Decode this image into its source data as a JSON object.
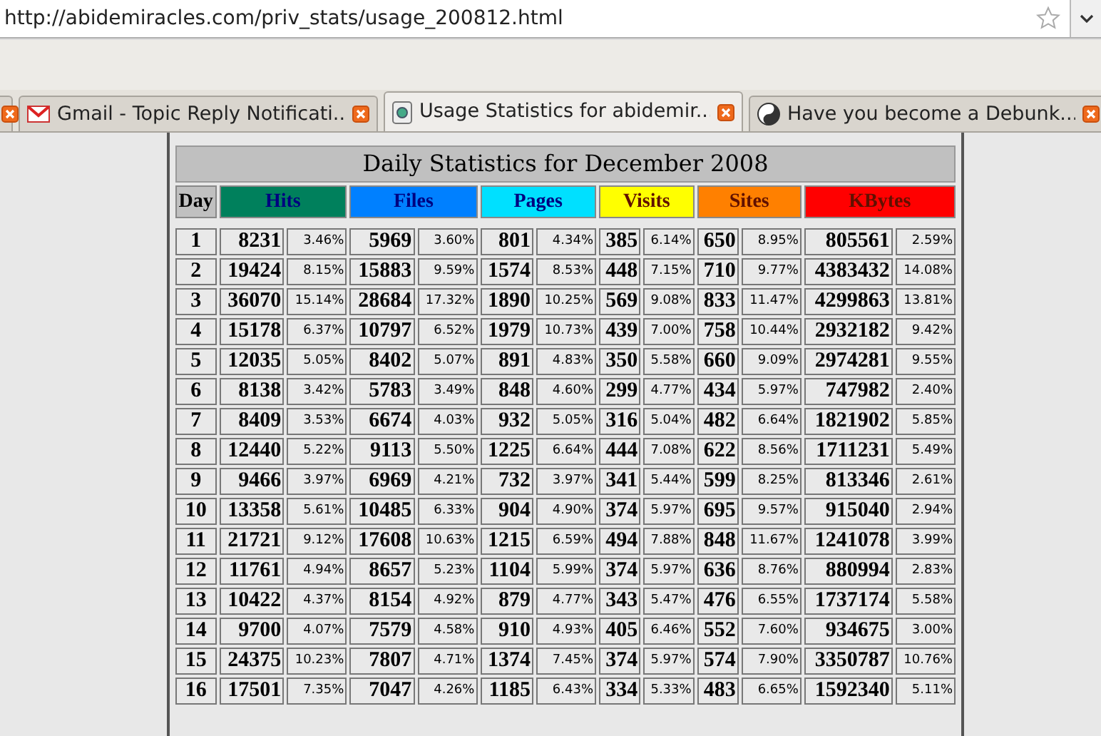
{
  "address_bar": {
    "url": "http://abidemiracles.com/priv_stats/usage_200812.html"
  },
  "tabs": [
    {
      "selected": false,
      "kind": "partial"
    },
    {
      "title": "Gmail - Topic Reply Notificati...",
      "selected": false,
      "kind": "mail"
    },
    {
      "title": "Usage Statistics for abidemir...",
      "selected": true,
      "kind": "page"
    },
    {
      "title": "Have you become a Debunk...",
      "selected": false,
      "kind": "yinyang"
    }
  ],
  "table": {
    "title": "Daily Statistics for December 2008",
    "columns": [
      {
        "label": "Day",
        "color": "#c0c0c0",
        "kind": "day"
      },
      {
        "label": "Hits",
        "color": "#00805c",
        "kind": "metric"
      },
      {
        "label": "Files",
        "color": "#0080ff",
        "kind": "metric"
      },
      {
        "label": "Pages",
        "color": "#00e0ff",
        "kind": "metric"
      },
      {
        "label": "Visits",
        "color": "#ffff00",
        "kind": "metric"
      },
      {
        "label": "Sites",
        "color": "#ff8000",
        "kind": "metric"
      },
      {
        "label": "KBytes",
        "color": "#ff0000",
        "kind": "metric"
      }
    ],
    "rows": [
      {
        "day": "1",
        "values": [
          [
            "8231",
            "3.46%"
          ],
          [
            "5969",
            "3.60%"
          ],
          [
            "801",
            "4.34%"
          ],
          [
            "385",
            "6.14%"
          ],
          [
            "650",
            "8.95%"
          ],
          [
            "805561",
            "2.59%"
          ]
        ]
      },
      {
        "day": "2",
        "values": [
          [
            "19424",
            "8.15%"
          ],
          [
            "15883",
            "9.59%"
          ],
          [
            "1574",
            "8.53%"
          ],
          [
            "448",
            "7.15%"
          ],
          [
            "710",
            "9.77%"
          ],
          [
            "4383432",
            "14.08%"
          ]
        ]
      },
      {
        "day": "3",
        "values": [
          [
            "36070",
            "15.14%"
          ],
          [
            "28684",
            "17.32%"
          ],
          [
            "1890",
            "10.25%"
          ],
          [
            "569",
            "9.08%"
          ],
          [
            "833",
            "11.47%"
          ],
          [
            "4299863",
            "13.81%"
          ]
        ]
      },
      {
        "day": "4",
        "values": [
          [
            "15178",
            "6.37%"
          ],
          [
            "10797",
            "6.52%"
          ],
          [
            "1979",
            "10.73%"
          ],
          [
            "439",
            "7.00%"
          ],
          [
            "758",
            "10.44%"
          ],
          [
            "2932182",
            "9.42%"
          ]
        ]
      },
      {
        "day": "5",
        "values": [
          [
            "12035",
            "5.05%"
          ],
          [
            "8402",
            "5.07%"
          ],
          [
            "891",
            "4.83%"
          ],
          [
            "350",
            "5.58%"
          ],
          [
            "660",
            "9.09%"
          ],
          [
            "2974281",
            "9.55%"
          ]
        ]
      },
      {
        "day": "6",
        "values": [
          [
            "8138",
            "3.42%"
          ],
          [
            "5783",
            "3.49%"
          ],
          [
            "848",
            "4.60%"
          ],
          [
            "299",
            "4.77%"
          ],
          [
            "434",
            "5.97%"
          ],
          [
            "747982",
            "2.40%"
          ]
        ]
      },
      {
        "day": "7",
        "values": [
          [
            "8409",
            "3.53%"
          ],
          [
            "6674",
            "4.03%"
          ],
          [
            "932",
            "5.05%"
          ],
          [
            "316",
            "5.04%"
          ],
          [
            "482",
            "6.64%"
          ],
          [
            "1821902",
            "5.85%"
          ]
        ]
      },
      {
        "day": "8",
        "values": [
          [
            "12440",
            "5.22%"
          ],
          [
            "9113",
            "5.50%"
          ],
          [
            "1225",
            "6.64%"
          ],
          [
            "444",
            "7.08%"
          ],
          [
            "622",
            "8.56%"
          ],
          [
            "1711231",
            "5.49%"
          ]
        ]
      },
      {
        "day": "9",
        "values": [
          [
            "9466",
            "3.97%"
          ],
          [
            "6969",
            "4.21%"
          ],
          [
            "732",
            "3.97%"
          ],
          [
            "341",
            "5.44%"
          ],
          [
            "599",
            "8.25%"
          ],
          [
            "813346",
            "2.61%"
          ]
        ]
      },
      {
        "day": "10",
        "values": [
          [
            "13358",
            "5.61%"
          ],
          [
            "10485",
            "6.33%"
          ],
          [
            "904",
            "4.90%"
          ],
          [
            "374",
            "5.97%"
          ],
          [
            "695",
            "9.57%"
          ],
          [
            "915040",
            "2.94%"
          ]
        ]
      },
      {
        "day": "11",
        "values": [
          [
            "21721",
            "9.12%"
          ],
          [
            "17608",
            "10.63%"
          ],
          [
            "1215",
            "6.59%"
          ],
          [
            "494",
            "7.88%"
          ],
          [
            "848",
            "11.67%"
          ],
          [
            "1241078",
            "3.99%"
          ]
        ]
      },
      {
        "day": "12",
        "values": [
          [
            "11761",
            "4.94%"
          ],
          [
            "8657",
            "5.23%"
          ],
          [
            "1104",
            "5.99%"
          ],
          [
            "374",
            "5.97%"
          ],
          [
            "636",
            "8.76%"
          ],
          [
            "880994",
            "2.83%"
          ]
        ]
      },
      {
        "day": "13",
        "values": [
          [
            "10422",
            "4.37%"
          ],
          [
            "8154",
            "4.92%"
          ],
          [
            "879",
            "4.77%"
          ],
          [
            "343",
            "5.47%"
          ],
          [
            "476",
            "6.55%"
          ],
          [
            "1737174",
            "5.58%"
          ]
        ]
      },
      {
        "day": "14",
        "values": [
          [
            "9700",
            "4.07%"
          ],
          [
            "7579",
            "4.58%"
          ],
          [
            "910",
            "4.93%"
          ],
          [
            "405",
            "6.46%"
          ],
          [
            "552",
            "7.60%"
          ],
          [
            "934675",
            "3.00%"
          ]
        ]
      },
      {
        "day": "15",
        "values": [
          [
            "24375",
            "10.23%"
          ],
          [
            "7807",
            "4.71%"
          ],
          [
            "1374",
            "7.45%"
          ],
          [
            "374",
            "5.97%"
          ],
          [
            "574",
            "7.90%"
          ],
          [
            "3350787",
            "10.76%"
          ]
        ]
      },
      {
        "day": "16",
        "values": [
          [
            "17501",
            "7.35%"
          ],
          [
            "7047",
            "4.26%"
          ],
          [
            "1185",
            "6.43%"
          ],
          [
            "334",
            "5.33%"
          ],
          [
            "483",
            "6.65%"
          ],
          [
            "1592340",
            "5.11%"
          ]
        ]
      }
    ]
  }
}
